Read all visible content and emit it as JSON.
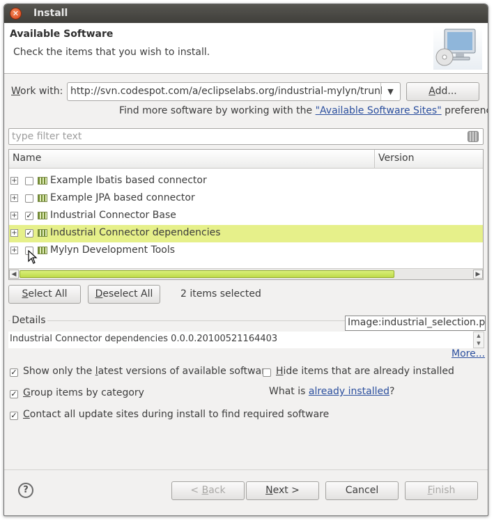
{
  "window": {
    "title": "Install"
  },
  "header": {
    "title": "Available Software",
    "subtitle": "Check the items that you wish to install.",
    "icon": "computer-cd-icon"
  },
  "work_with": {
    "label": "Work with:",
    "value": "http://svn.codespot.com/a/eclipselabs.org/industrial-mylyn/trunk/com",
    "add_label": "Add...",
    "hint_prefix": "Find more software by working with the ",
    "hint_link": "\"Available Software Sites\"",
    "hint_suffix": " preferences."
  },
  "filter": {
    "placeholder": "type filter text"
  },
  "tree": {
    "columns": [
      "Name",
      "Version"
    ],
    "rows": [
      {
        "name": "Example Ibatis based connector",
        "checked": false,
        "selected": false
      },
      {
        "name": "Example JPA based connector",
        "checked": false,
        "selected": false
      },
      {
        "name": "Industrial Connector Base",
        "checked": true,
        "selected": false
      },
      {
        "name": "Industrial Connector dependencies",
        "checked": true,
        "selected": true
      },
      {
        "name": "Mylyn Development Tools",
        "checked": false,
        "selected": false
      }
    ]
  },
  "selection": {
    "select_all": "Select All",
    "deselect_all": "Deselect All",
    "count_text": "2 items selected"
  },
  "details": {
    "legend": "Details",
    "image_tag": "Image:industrial_selection.png",
    "text": "Industrial Connector dependencies 0.0.0.20100521164403",
    "more_link": "More..."
  },
  "options": {
    "latest_only": "Show only the latest versions of available software",
    "hide_installed": "Hide items that are already installed",
    "group_by_category": "Group items by category",
    "what_is_prefix": "What is ",
    "what_is_link": "already installed",
    "what_is_suffix": "?",
    "contact_sites": "Contact all update sites during install to find required software"
  },
  "footer": {
    "back": "< Back",
    "next": "Next >",
    "cancel": "Cancel",
    "finish": "Finish"
  },
  "colors": {
    "selection_row": "#e6f08a",
    "link": "#2b4f9e",
    "titlebar": "#4b4a46"
  }
}
